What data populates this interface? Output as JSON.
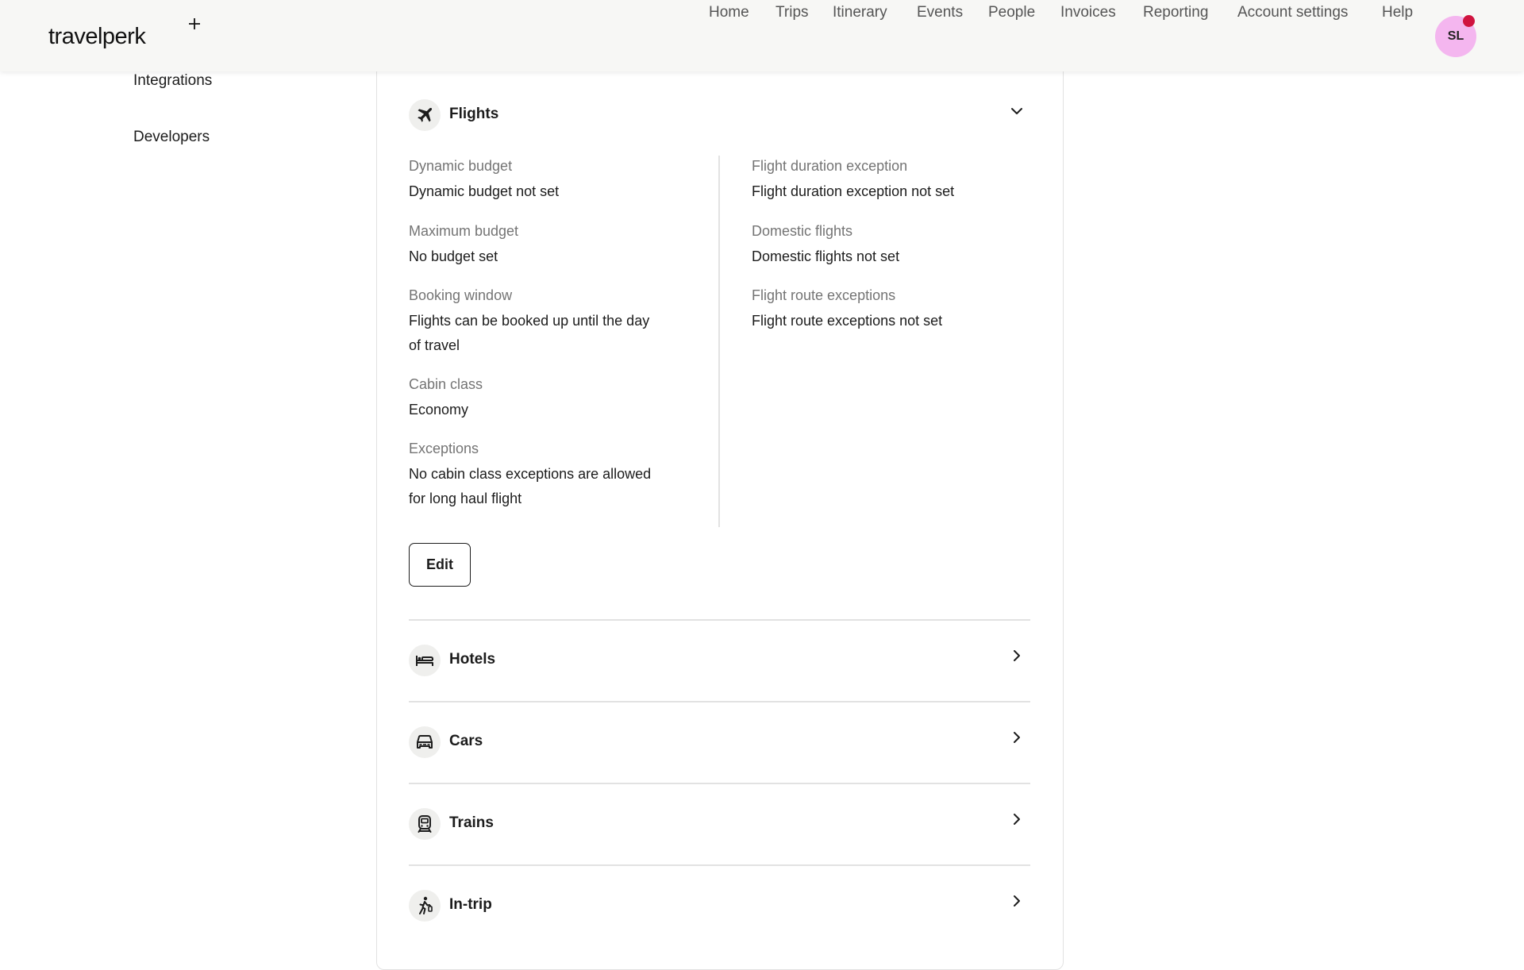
{
  "header": {
    "logo": "travelperk",
    "nav": [
      "Home",
      "Trips",
      "Itinerary",
      "Events",
      "People",
      "Invoices",
      "Reporting",
      "Account settings",
      "Help"
    ],
    "avatar_initials": "SL",
    "notification_color": "#d0143f",
    "avatar_color": "#f4b6ef"
  },
  "sidebar": {
    "items": [
      "Integrations",
      "Developers"
    ]
  },
  "flights": {
    "title": "Flights",
    "icon": "plane-icon",
    "left": [
      {
        "label": "Dynamic budget",
        "value": "Dynamic budget not set"
      },
      {
        "label": "Maximum budget",
        "value": "No budget set"
      },
      {
        "label": "Booking window",
        "value_line1": "Flights can be booked up until the day",
        "value_line2": "of travel"
      },
      {
        "label": "Cabin class",
        "value": "Economy"
      },
      {
        "label": "Exceptions",
        "value_line1": "No cabin class exceptions are allowed",
        "value_line2": "for long haul flight"
      }
    ],
    "right": [
      {
        "label": "Flight duration exception",
        "value": "Flight duration exception not set"
      },
      {
        "label": "Domestic flights",
        "value": "Domestic flights not set"
      },
      {
        "label": "Flight route exceptions",
        "value": "Flight route exceptions not set"
      }
    ],
    "edit_label": "Edit"
  },
  "sections": [
    {
      "title": "Hotels",
      "icon": "bed-icon"
    },
    {
      "title": "Cars",
      "icon": "car-icon"
    },
    {
      "title": "Trains",
      "icon": "train-icon"
    },
    {
      "title": "In-trip",
      "icon": "walking-traveler-icon"
    }
  ]
}
